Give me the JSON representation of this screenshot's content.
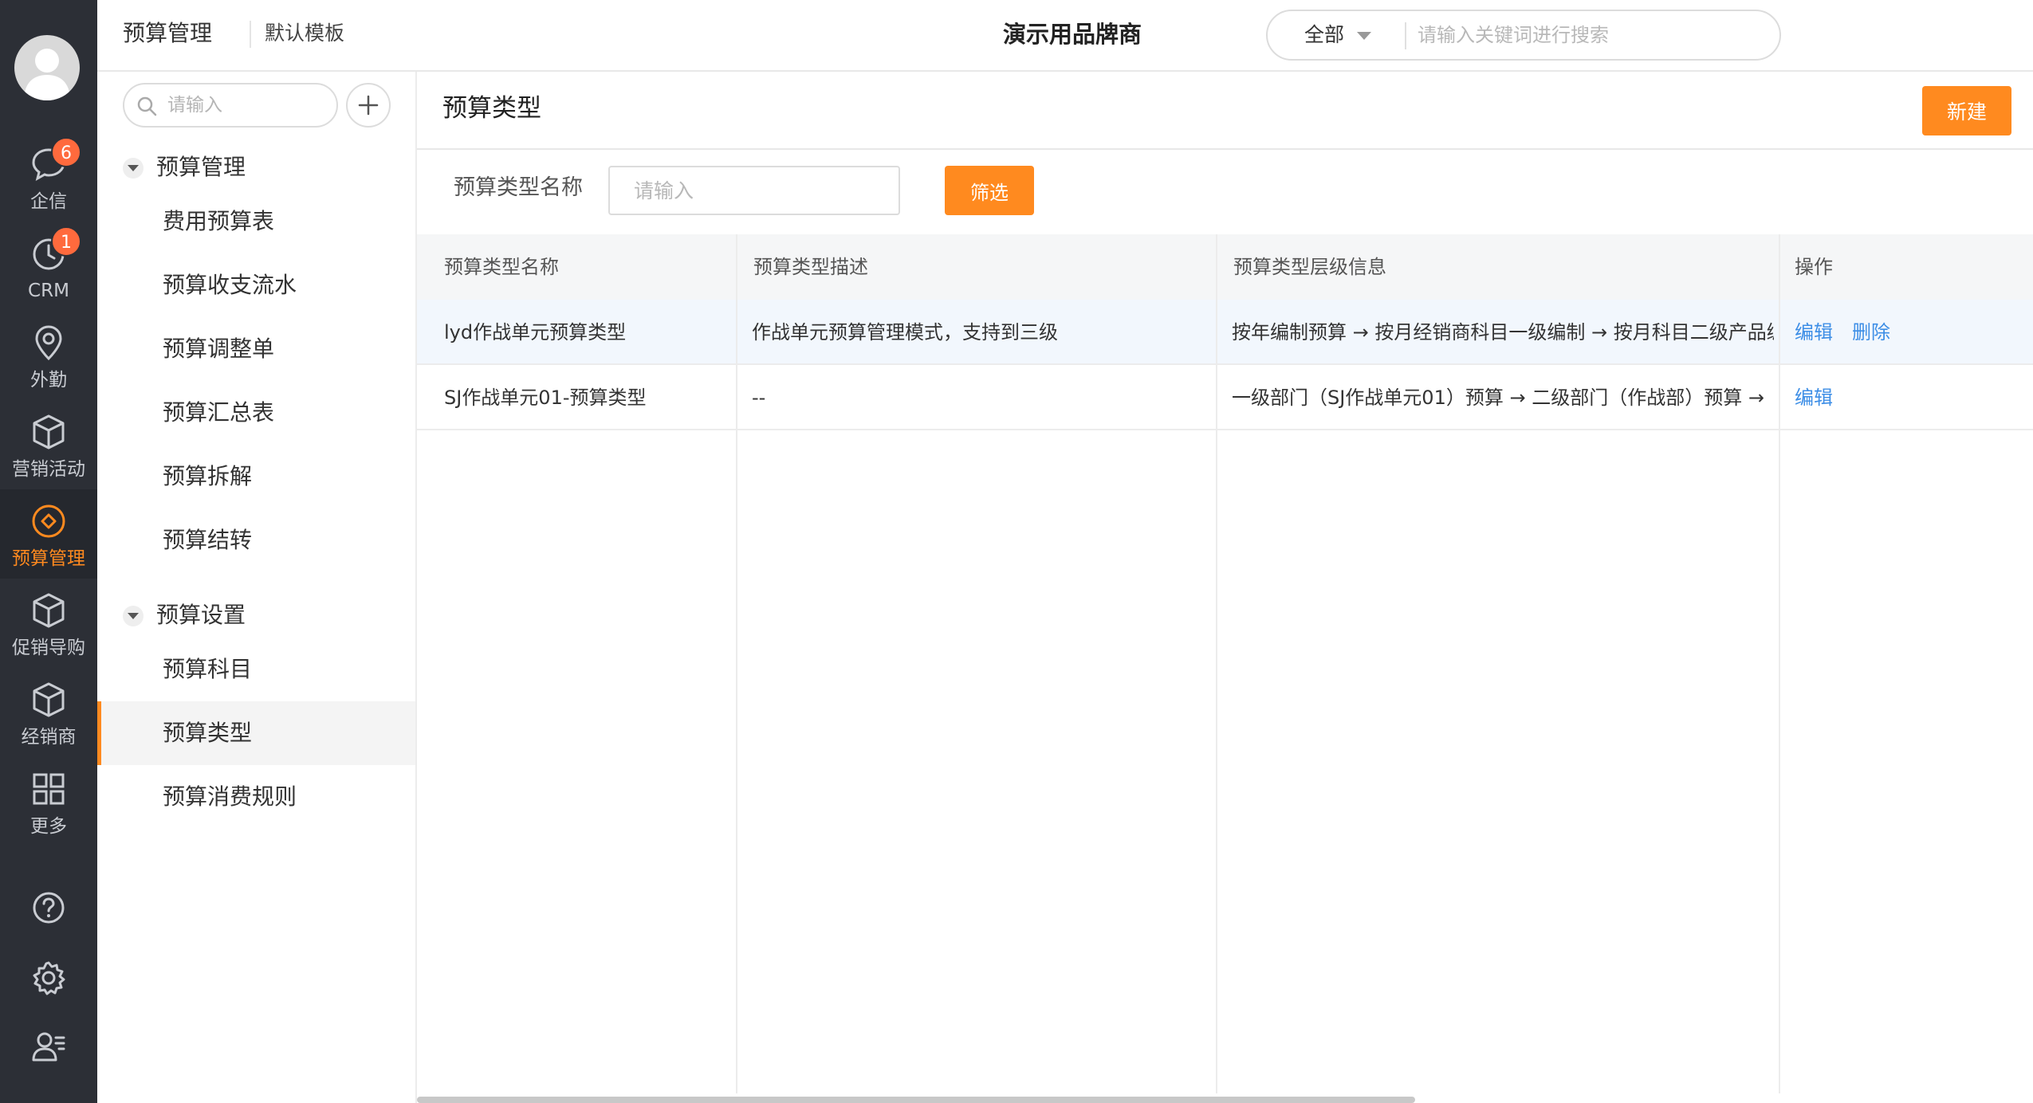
{
  "rail": {
    "items": [
      {
        "label": "企信",
        "badge": "6",
        "icon": "chat-bubble-icon"
      },
      {
        "label": "CRM",
        "badge": "1",
        "icon": "clock-icon"
      },
      {
        "label": "外勤",
        "badge": "",
        "icon": "location-pin-icon"
      },
      {
        "label": "营销活动",
        "badge": "",
        "icon": "cube-icon"
      },
      {
        "label": "预算管理",
        "badge": "",
        "icon": "budget-diamond-icon",
        "active": true
      },
      {
        "label": "促销导购",
        "badge": "",
        "icon": "cube-icon"
      },
      {
        "label": "经销商",
        "badge": "",
        "icon": "cube-icon"
      },
      {
        "label": "更多",
        "badge": "",
        "icon": "grid-icon"
      }
    ],
    "bottom_icons": [
      "help-icon",
      "settings-gear-icon",
      "user-profile-icon"
    ]
  },
  "header": {
    "module": "预算管理",
    "template": "默认模板",
    "company": "演示用品牌商",
    "search": {
      "scope": "全部",
      "placeholder": "请输入关键词进行搜索"
    }
  },
  "subnav": {
    "search_placeholder": "请输入",
    "groups": [
      {
        "label": "预算管理",
        "items": [
          "费用预算表",
          "预算收支流水",
          "预算调整单",
          "预算汇总表",
          "预算拆解",
          "预算结转"
        ]
      },
      {
        "label": "预算设置",
        "items": [
          "预算科目",
          "预算类型",
          "预算消费规则"
        ]
      }
    ],
    "active_item": "预算类型"
  },
  "main": {
    "title": "预算类型",
    "new_button": "新建",
    "filter": {
      "label": "预算类型名称",
      "placeholder": "请输入",
      "button": "筛选"
    },
    "table": {
      "columns": [
        "预算类型名称",
        "预算类型描述",
        "预算类型层级信息",
        "操作"
      ],
      "rows": [
        {
          "name": "lyd作战单元预算类型",
          "desc": "作战单元预算管理模式，支持到三级",
          "levels": "按年编制预算 → 按月经销商科目一级编制 → 按月科目二级产品编制",
          "actions": [
            "编辑",
            "删除"
          ]
        },
        {
          "name": "SJ作战单元01-预算类型",
          "desc": "--",
          "levels": "一级部门（SJ作战单元01）预算 → 二级部门（作战部）预算 →",
          "actions": [
            "编辑"
          ]
        }
      ]
    }
  },
  "colors": {
    "accent": "#ff8a1f",
    "rail_bg": "#2c2f36",
    "link": "#3d8ee6",
    "badge": "#ff6a3d"
  }
}
